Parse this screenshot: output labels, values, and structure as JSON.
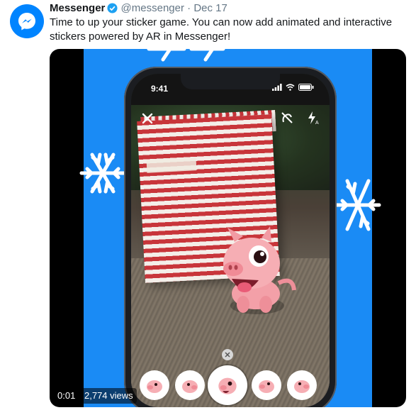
{
  "tweet": {
    "name": "Messenger",
    "handle": "@messenger",
    "separator": "·",
    "date": "Dec 17",
    "text": "Time to up your sticker game. You can now add animated and interactive stickers powered by AR in Messenger!"
  },
  "video": {
    "elapsed": "0:01",
    "views": "2,774 views",
    "phone_time": "9:41"
  },
  "icons": {
    "avatar": "messenger-logo-icon",
    "verified": "verified-badge-icon",
    "close": "close-icon",
    "effects": "effects-off-icon",
    "flash": "flash-auto-icon",
    "dismiss": "close-small-icon"
  },
  "colors": {
    "brand": "#0084ff",
    "video_background": "#1a8bf5",
    "verified": "#1da1f2"
  }
}
